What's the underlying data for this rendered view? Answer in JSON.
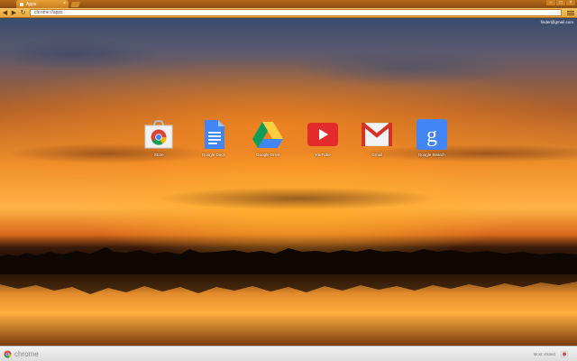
{
  "tabstrip": {
    "tab_label": "Apps",
    "tab_close": "×"
  },
  "toolbar": {
    "back": "◀",
    "forward": "▶",
    "reload": "↻",
    "url": "chrome://apps"
  },
  "user": {
    "email": "finder@gmail.com"
  },
  "apps": [
    {
      "label": "Store",
      "icon": "web-store-icon"
    },
    {
      "label": "Google Docs",
      "icon": "google-docs-icon"
    },
    {
      "label": "Google Drive",
      "icon": "google-drive-icon"
    },
    {
      "label": "YouTube",
      "icon": "youtube-icon"
    },
    {
      "label": "Gmail",
      "icon": "gmail-icon"
    },
    {
      "label": "Google Search",
      "icon": "google-search-icon"
    }
  ],
  "bottombar": {
    "brand": "chrome",
    "most_visited": "Most Visited"
  },
  "colors": {
    "theme_orange": "#e8a73c",
    "youtube_red": "#e32b2b",
    "gmail_red": "#d93025",
    "google_blue": "#4285f4"
  }
}
